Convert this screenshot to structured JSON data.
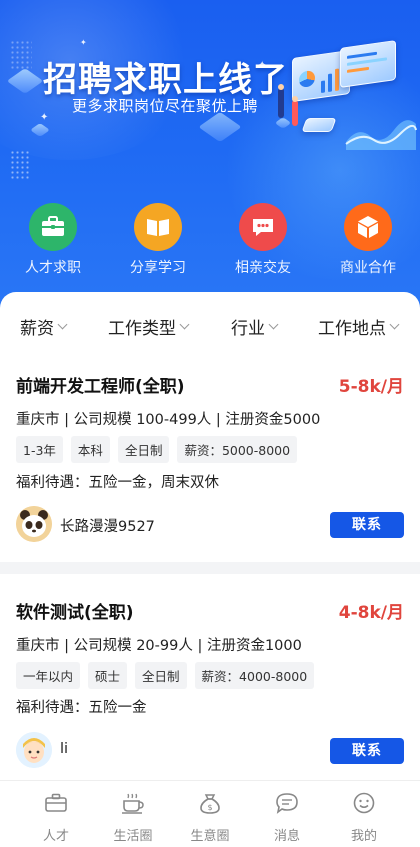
{
  "banner": {
    "title": "招聘求职上线了",
    "subtitle": "更多求职岗位尽在聚优上聘"
  },
  "categories": [
    {
      "label": "人才求职",
      "color": "#2db56a",
      "icon": "briefcase-icon"
    },
    {
      "label": "分享学习",
      "color": "#f5a623",
      "icon": "book-icon"
    },
    {
      "label": "相亲交友",
      "color": "#ef4b4b",
      "icon": "chat-icon"
    },
    {
      "label": "商业合作",
      "color": "#ff6a1a",
      "icon": "cube-icon"
    }
  ],
  "filters": [
    {
      "label": "薪资"
    },
    {
      "label": "工作类型"
    },
    {
      "label": "行业"
    },
    {
      "label": "工作地点"
    }
  ],
  "jobs": [
    {
      "title": "前端开发工程师(全职)",
      "salary": "5-8k/月",
      "info": "重庆市 | 公司规模 100-499人 | 注册资金5000",
      "tags": [
        "1-3年",
        "本科",
        "全日制",
        "薪资：5000-8000"
      ],
      "benefit": "福利待遇：五险一金，周末双休",
      "user": "长路漫漫9527",
      "contact": "联系",
      "avatar": "panda-avatar"
    },
    {
      "title": "软件测试(全职)",
      "salary": "4-8k/月",
      "info": "重庆市 | 公司规模 20-99人 | 注册资金1000",
      "tags": [
        "一年以内",
        "硕士",
        "全日制",
        "薪资：4000-8000"
      ],
      "benefit": "福利待遇：五险一金",
      "user": "li",
      "contact": "联系",
      "avatar": "cartoon-avatar"
    }
  ],
  "tabbar": [
    {
      "label": "人才",
      "icon": "briefcase-icon"
    },
    {
      "label": "生活圈",
      "icon": "coffee-icon"
    },
    {
      "label": "生意圈",
      "icon": "money-bag-icon"
    },
    {
      "label": "消息",
      "icon": "message-icon"
    },
    {
      "label": "我的",
      "icon": "smile-icon"
    }
  ]
}
